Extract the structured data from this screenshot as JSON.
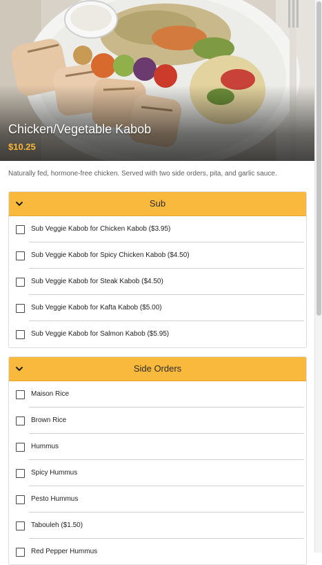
{
  "item": {
    "title": "Chicken/Vegetable Kabob",
    "price": "$10.25",
    "description": "Naturally fed, hormone-free chicken. Served with two side orders, pita, and garlic sauce."
  },
  "groups": [
    {
      "title": "Sub",
      "options": [
        "Sub Veggie Kabob for Chicken Kabob ($3.95)",
        "Sub Veggie Kabob for Spicy Chicken Kabob ($4.50)",
        "Sub Veggie Kabob for Steak Kabob ($4.50)",
        "Sub Veggie Kabob for Kafta Kabob ($5.00)",
        "Sub Veggie Kabob for Salmon Kabob ($5.95)"
      ]
    },
    {
      "title": "Side Orders",
      "options": [
        "Maison Rice",
        "Brown Rice",
        "Hummus",
        "Spicy Hummus",
        "Pesto Hummus",
        "Tabouleh ($1.50)",
        "Red Pepper Hummus"
      ]
    }
  ],
  "colors": {
    "accent": "#f9b93c",
    "price": "#f5b63a"
  },
  "icons": {
    "collapse": "chevron-down-icon",
    "checkbox": "checkbox-icon"
  }
}
